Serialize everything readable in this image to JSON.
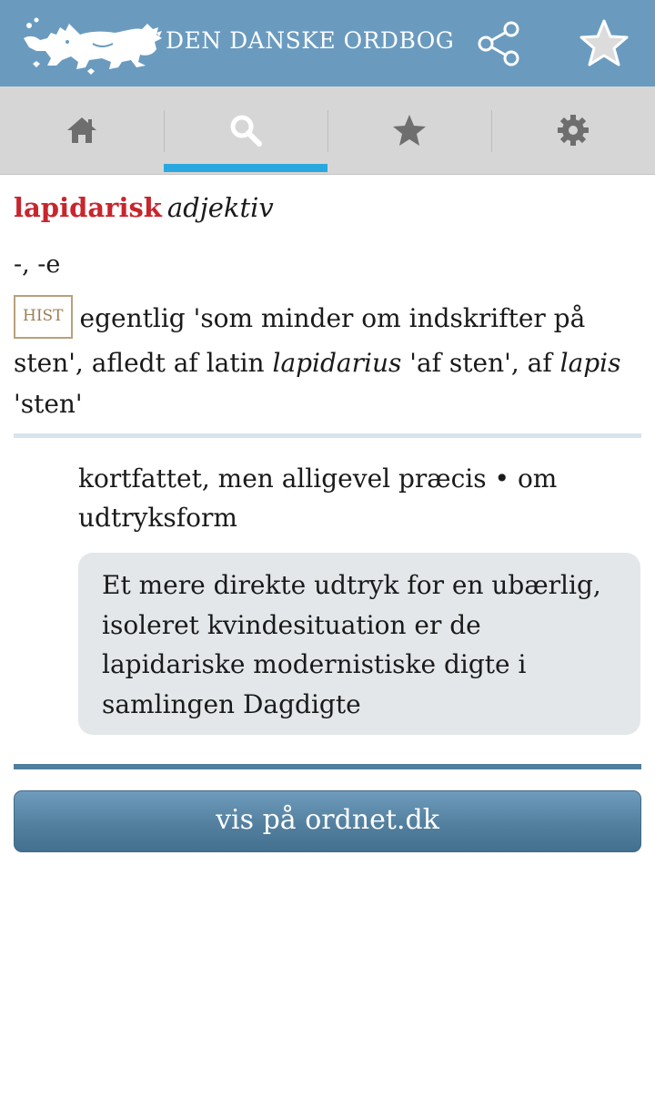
{
  "header": {
    "title": "DEN DANSKE ORDBOG",
    "logo_icon": "lion-crest-icon",
    "share_icon": "share-icon",
    "favorite_icon": "star-outline-icon"
  },
  "tabs": [
    {
      "id": "home",
      "icon": "home-icon",
      "active": false
    },
    {
      "id": "search",
      "icon": "search-icon",
      "active": true
    },
    {
      "id": "favorites",
      "icon": "star-icon",
      "active": false
    },
    {
      "id": "settings",
      "icon": "gear-icon",
      "active": false
    }
  ],
  "entry": {
    "headword": "lapidarisk",
    "pos": "adjektiv",
    "inflection": "-, -e",
    "etymology": {
      "badge": "HIST",
      "text_1": "egentlig 'som minder om indskrifter på sten', afledt af latin ",
      "term_1": "lapidarius",
      "text_2": " 'af sten', af ",
      "term_2": "lapis",
      "text_3": " 'sten'"
    },
    "definition": "kortfattet, men alligevel præcis • om udtryksform",
    "example": "Et mere direkte udtryk for en ubærlig, isoleret kvindesituation er de lapidariske modernistiske digte i samlingen Dagdigte"
  },
  "actions": {
    "ordnet_label": "vis på ordnet.dk"
  },
  "colors": {
    "header_bg": "#6a9bbf",
    "tab_bar_bg": "#d6d6d6",
    "tab_active_indicator": "#29a8e0",
    "headword": "#c8252d",
    "button_bg": "#53809f"
  }
}
